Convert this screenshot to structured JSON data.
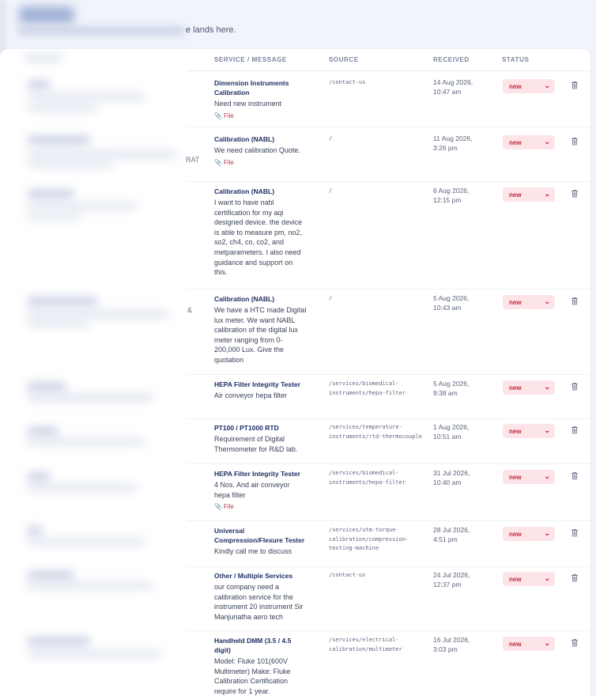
{
  "header": {
    "subtitle_tail": "e lands here."
  },
  "left_clips": [
    "RAT",
    "&"
  ],
  "table": {
    "columns": [
      "SERVICE / MESSAGE",
      "SOURCE",
      "RECEIVED",
      "STATUS"
    ],
    "rows": [
      {
        "service": "Dimension Instruments Calibration",
        "message": "Need new instrument",
        "file": "File",
        "source": "/contact-us",
        "received_date": "14 Aug 2026,",
        "received_time": "10:47 am",
        "status": "new"
      },
      {
        "service": "Calibration (NABL)",
        "message": "We need calibration Quote.",
        "file": "File",
        "source": "/",
        "received_date": "11 Aug 2026,",
        "received_time": "3:26 pm",
        "status": "new"
      },
      {
        "service": "Calibration (NABL)",
        "message": "I want to have nabl certification for my aqi designed device. the device is able to measure pm, no2, so2, ch4, co, co2, and metparameters. I also need guidance and support on this.",
        "file": "",
        "source": "/",
        "received_date": "6 Aug 2026,",
        "received_time": "12:15 pm",
        "status": "new"
      },
      {
        "service": "Calibration (NABL)",
        "message": "We have a HTC made Digital lux meter. We want NABL calibration of the digital lux meter ranging from 0-200,000 Lux. Give the quotation",
        "file": "",
        "source": "/",
        "received_date": "5 Aug 2026,",
        "received_time": "10:43 am",
        "status": "new"
      },
      {
        "service": "HEPA Filter Integrity Tester",
        "message": "Air conveyor hepa filter",
        "file": "",
        "source": "/services/biomedical-instruments/hepa-filter",
        "received_date": "5 Aug 2026,",
        "received_time": "9:38 am",
        "status": "new"
      },
      {
        "service": "PT100 / PT1000 RTD",
        "message": "Requirement of Digital Thermometer for R&D lab.",
        "file": "",
        "source": "/services/temperature-instruments/rtd-thermocouple",
        "received_date": "1 Aug 2026,",
        "received_time": "10:51 am",
        "status": "new"
      },
      {
        "service": "HEPA Filter Integrity Tester",
        "message": "4 Nos. And air conveyor hepa filter",
        "file": "File",
        "source": "/services/biomedical-instruments/hepa-filter",
        "received_date": "31 Jul 2026,",
        "received_time": "10:40 am",
        "status": "new"
      },
      {
        "service": "Universal Compression/Flexure Tester",
        "message": "Kindly call me to discuss",
        "file": "",
        "source": "/services/utm-torque-calibration/compression-testing-machine",
        "received_date": "28 Jul 2026,",
        "received_time": "4:51 pm",
        "status": "new"
      },
      {
        "service": "Other / Multiple Services",
        "message": "our company need a calibration service for the instrument 20 instrument Sir Manjunatha aero tech",
        "file": "",
        "source": "/contact-us",
        "received_date": "24 Jul 2026,",
        "received_time": "12:37 pm",
        "status": "new"
      },
      {
        "service": "Handheld DMM (3.5 / 4.5 digit)",
        "message": "Model: Fluke 101(600V Multimeter) Make: Fluke Calibration Certification require for 1 year.",
        "file": "",
        "source": "/services/electrical-calibration/multimeter",
        "received_date": "16 Jul 2026,",
        "received_time": "3:03 pm",
        "status": "new"
      }
    ]
  },
  "colors": {
    "accent": "#1f2f63",
    "status_bg": "#fde4e8",
    "status_text": "#c0263d"
  },
  "icons": {
    "delete": "trash-icon",
    "file": "paperclip-icon",
    "dropdown": "chevron-down-icon"
  }
}
